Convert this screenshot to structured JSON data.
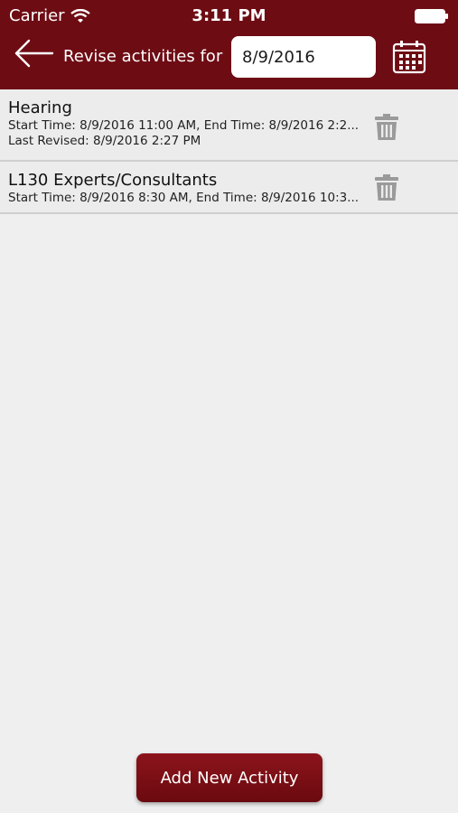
{
  "status_bar": {
    "carrier": "Carrier",
    "time": "3:11 PM"
  },
  "header": {
    "title": "Revise activities for",
    "date_value": "8/9/2016"
  },
  "activities": [
    {
      "title": "Hearing",
      "line1": "Start Time: 8/9/2016 11:00 AM, End Time: 8/9/2016 2:2...",
      "line2": "Last Revised: 8/9/2016 2:27 PM"
    },
    {
      "title": "L130  Experts/Consultants",
      "line1": "Start Time: 8/9/2016 8:30 AM, End Time: 8/9/2016 10:3..."
    }
  ],
  "footer": {
    "add_label": "Add New Activity"
  },
  "colors": {
    "header_bg": "#6e0c14",
    "button_bg": "#7c0f16",
    "list_bg": "#efefef"
  }
}
